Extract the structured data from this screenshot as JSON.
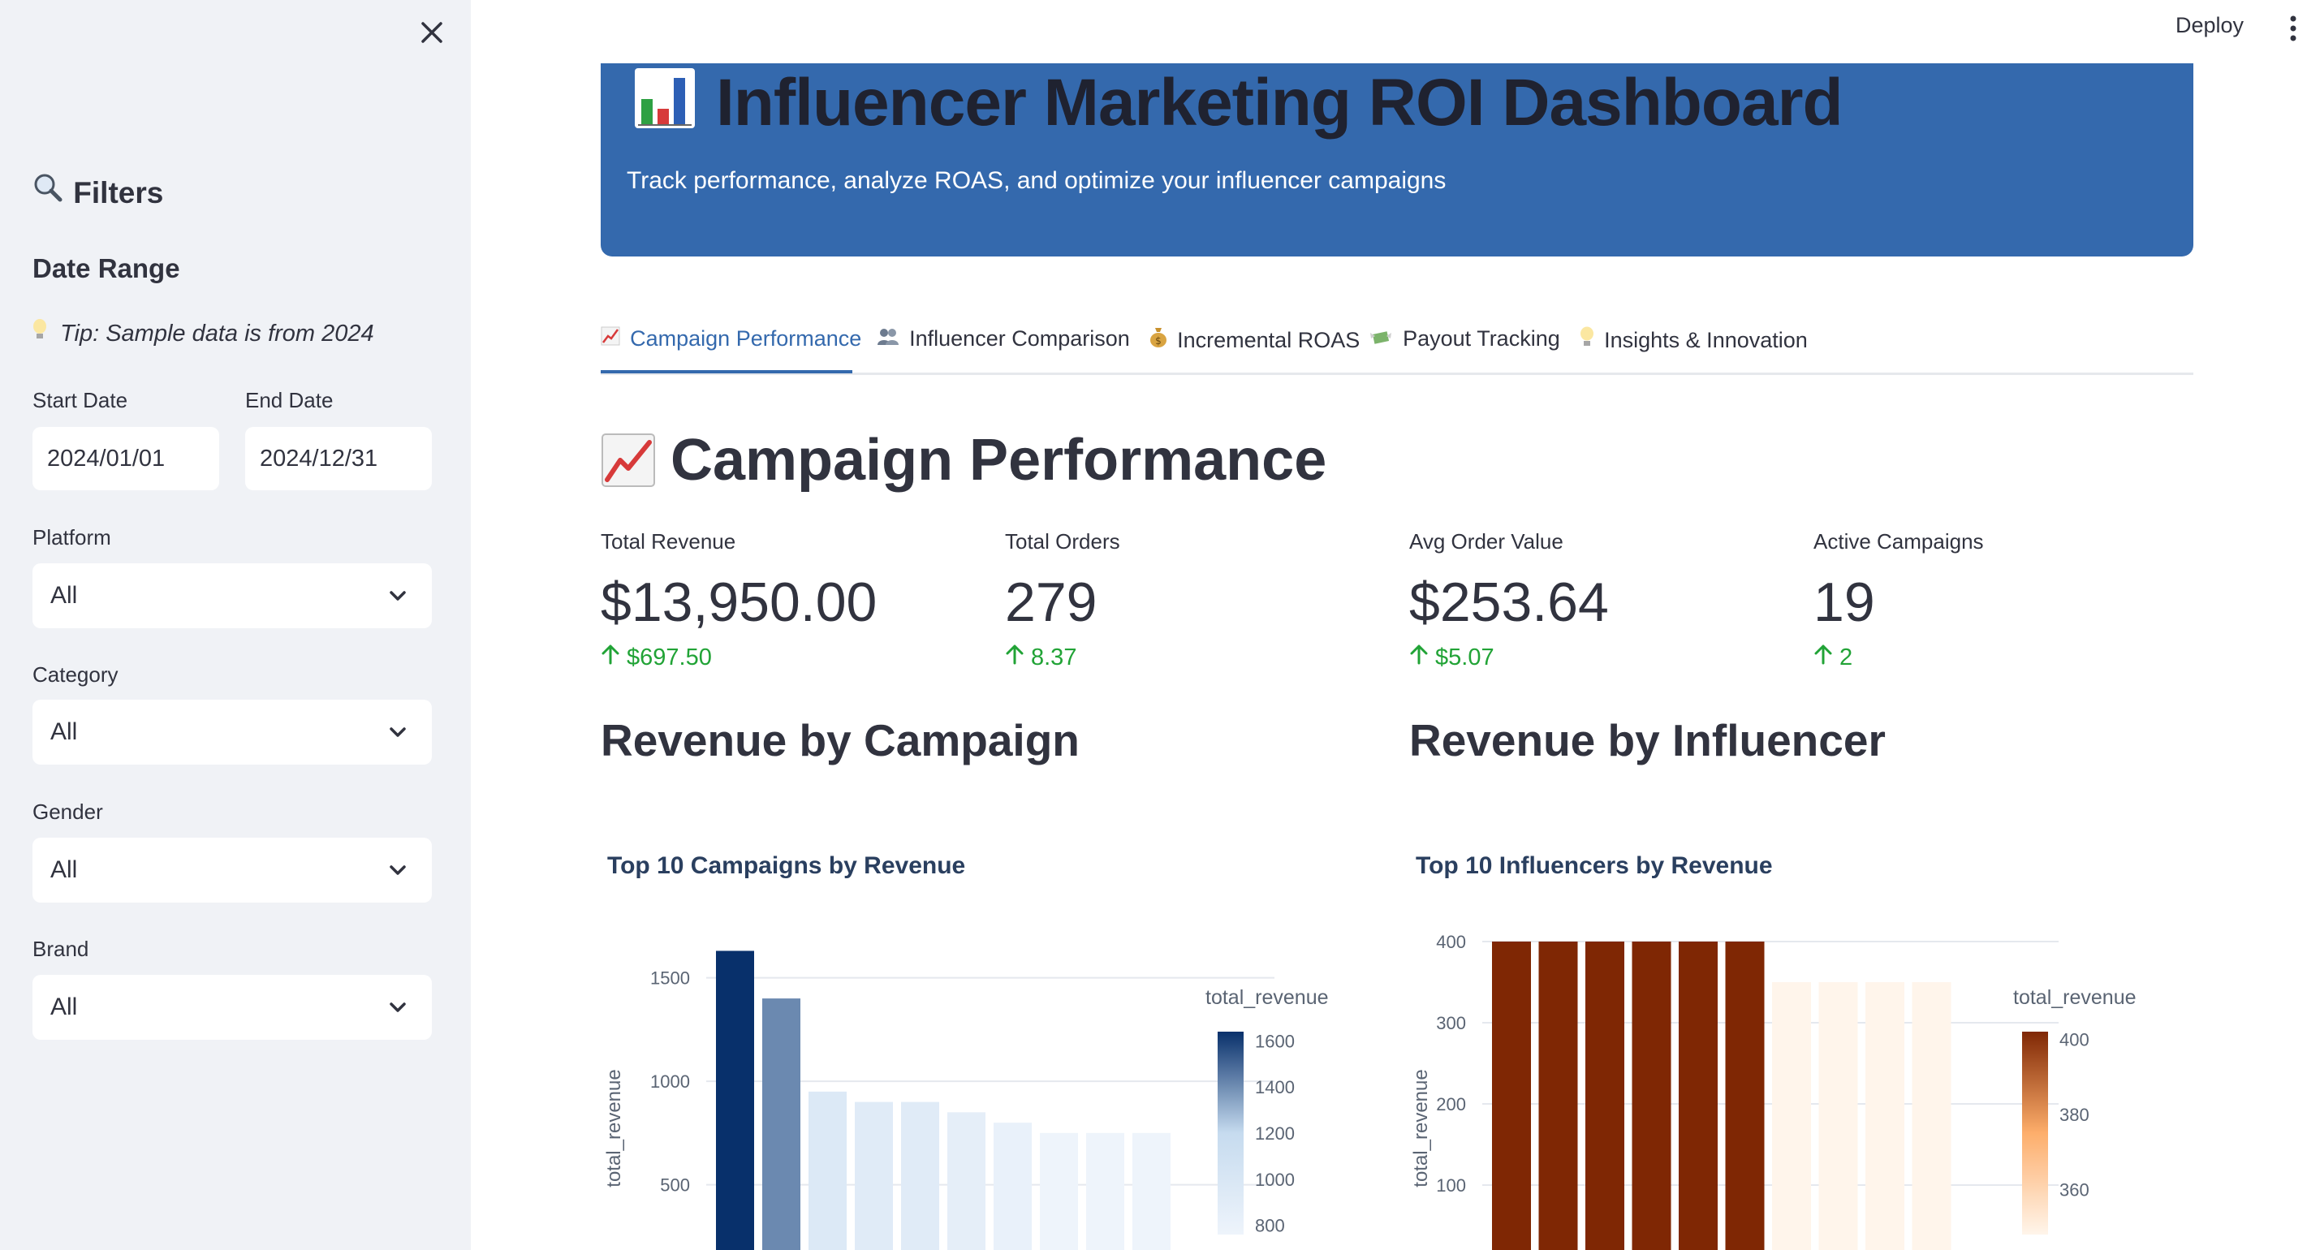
{
  "sidebar": {
    "filters_title": "Filters",
    "date_range_title": "Date Range",
    "tip": "Tip: Sample data is from 2024",
    "start_date_label": "Start Date",
    "start_date_value": "2024/01/01",
    "end_date_label": "End Date",
    "end_date_value": "2024/12/31",
    "platform_label": "Platform",
    "platform_value": "All",
    "category_label": "Category",
    "category_value": "All",
    "gender_label": "Gender",
    "gender_value": "All",
    "brand_label": "Brand",
    "brand_value": "All"
  },
  "topbar": {
    "deploy_label": "Deploy"
  },
  "header": {
    "title": "Influencer Marketing ROI Dashboard",
    "subtitle": "Track performance, analyze ROAS, and optimize your influencer campaigns",
    "color": "#3469ad"
  },
  "tabs": [
    {
      "label": "Campaign Performance",
      "icon": "chart-up-icon",
      "active": true
    },
    {
      "label": "Influencer Comparison",
      "icon": "people-icon"
    },
    {
      "label": "Incremental ROAS",
      "icon": "money-bag-icon"
    },
    {
      "label": "Payout Tracking",
      "icon": "money-wings-icon"
    },
    {
      "label": "Insights & Innovation",
      "icon": "bulb-icon"
    }
  ],
  "section_title": "Campaign Performance",
  "metrics": [
    {
      "label": "Total Revenue",
      "value": "$13,950.00",
      "delta": "$697.50"
    },
    {
      "label": "Total Orders",
      "value": "279",
      "delta": "8.37"
    },
    {
      "label": "Avg Order Value",
      "value": "$253.64",
      "delta": "$5.07"
    },
    {
      "label": "Active Campaigns",
      "value": "19",
      "delta": "2"
    }
  ],
  "charts": {
    "campaign_heading": "Revenue by Campaign",
    "influencer_heading": "Revenue by Influencer"
  },
  "chart_data": [
    {
      "type": "bar",
      "title": "Top 10 Campaigns by Revenue",
      "ylabel": "total_revenue",
      "values": [
        1630,
        1400,
        950,
        900,
        900,
        850,
        800,
        750,
        750,
        750
      ],
      "yticks": [
        500,
        1000,
        1500
      ],
      "colorbar": {
        "title": "total_revenue",
        "ticks": [
          1600,
          1400,
          1200,
          1000,
          800
        ],
        "scale": "Blues"
      }
    },
    {
      "type": "bar",
      "title": "Top 10 Influencers by Revenue",
      "ylabel": "total_revenue",
      "values": [
        400,
        400,
        400,
        400,
        400,
        400,
        350,
        350,
        350,
        350
      ],
      "yticks": [
        100,
        200,
        300,
        400
      ],
      "colorbar": {
        "title": "total_revenue",
        "ticks": [
          400,
          380,
          360
        ],
        "scale": "Oranges"
      }
    }
  ]
}
